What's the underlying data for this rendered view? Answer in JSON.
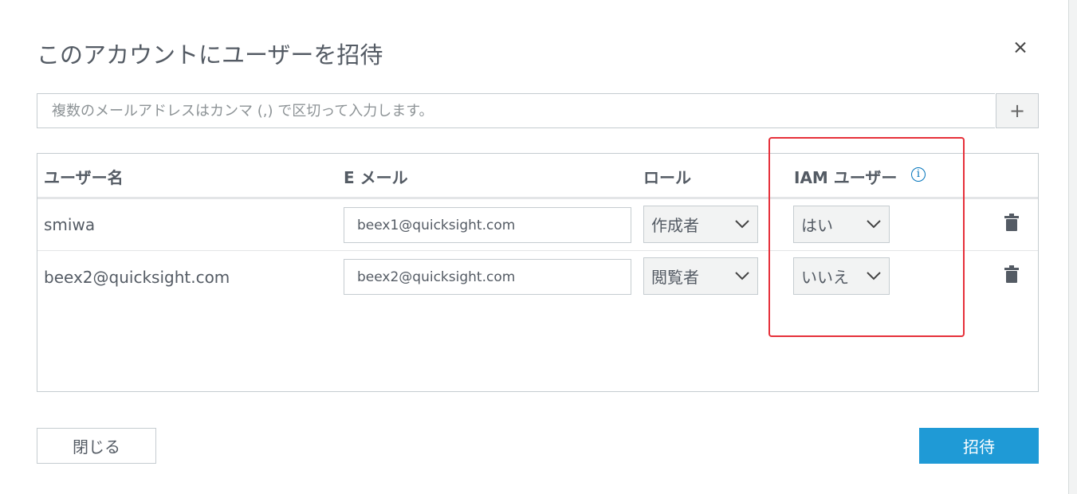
{
  "dialog": {
    "title": "このアカウントにユーザーを招待",
    "close_icon": "close-icon"
  },
  "email_entry": {
    "placeholder": "複数のメールアドレスはカンマ (,) で区切って入力します。",
    "value": "",
    "add_label": "+"
  },
  "table": {
    "columns": {
      "username": "ユーザー名",
      "email": "E メール",
      "role": "ロール",
      "iam_user": "IAM ユーザー"
    },
    "info_glyph": "i",
    "rows": [
      {
        "username": "smiwa",
        "email": "beex1@quicksight.com",
        "role": "作成者",
        "iam_user": "はい"
      },
      {
        "username": "beex2@quicksight.com",
        "email": "beex2@quicksight.com",
        "role": "閲覧者",
        "iam_user": "いいえ"
      }
    ]
  },
  "footer": {
    "close_label": "閉じる",
    "invite_label": "招待"
  },
  "colors": {
    "accent": "#1f9ad6",
    "info": "#0073bb",
    "highlight": "#e6303a"
  }
}
